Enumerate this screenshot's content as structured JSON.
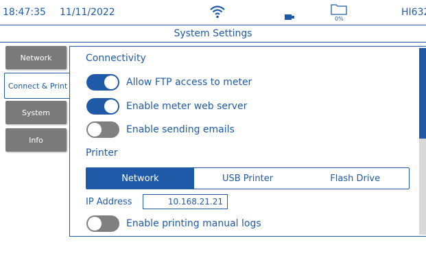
{
  "status_bar": {
    "time": "18:47:35",
    "date": "11/11/2022",
    "storage_percent": "0%",
    "model": "HI632"
  },
  "page_title": "System Settings",
  "tabs": [
    {
      "label": "Network"
    },
    {
      "label": "Connect & Print"
    },
    {
      "label": "System"
    },
    {
      "label": "Info"
    }
  ],
  "connectivity": {
    "heading": "Connectivity",
    "toggles": [
      {
        "label": "Allow FTP access to meter",
        "on": true
      },
      {
        "label": "Enable meter web server",
        "on": true
      },
      {
        "label": "Enable sending emails",
        "on": false
      }
    ]
  },
  "printer": {
    "heading": "Printer",
    "options": [
      "Network",
      "USB Printer",
      "Flash Drive"
    ],
    "selected": "Network",
    "ip_label": "IP Address",
    "ip_value": "10.168.21.21",
    "manual_logs": {
      "label": "Enable printing manual logs",
      "on": false
    }
  },
  "colors": {
    "accent": "#1e5aa8",
    "tab_inactive": "#7a7a7a",
    "toggle_off": "#808080"
  }
}
